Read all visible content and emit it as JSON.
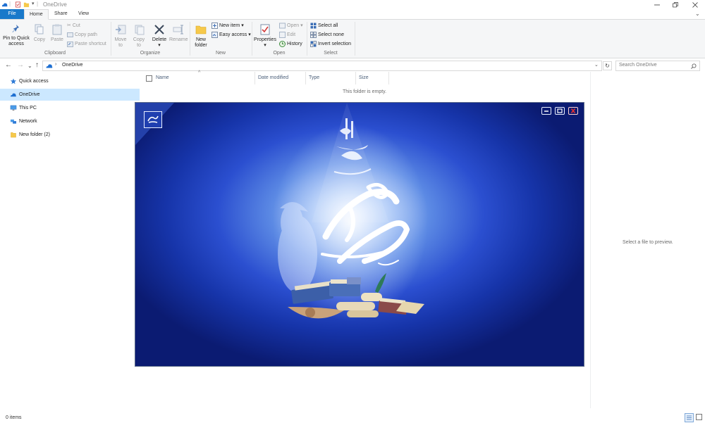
{
  "window": {
    "title": "OneDrive",
    "controls": {
      "minimize_icon": "minimize-icon",
      "restore_icon": "restore-icon",
      "close_icon": "close-icon"
    }
  },
  "tabs": [
    "File",
    "Home",
    "Share",
    "View"
  ],
  "ribbon": {
    "clipboard": {
      "label": "Clipboard",
      "pin": "Pin to Quick access",
      "pin_line1": "Pin to Quick",
      "pin_line2": "access",
      "copy": "Copy",
      "paste": "Paste",
      "cut": "Cut",
      "copy_path": "Copy path",
      "paste_shortcut": "Paste shortcut"
    },
    "organize": {
      "label": "Organize",
      "move_to_1": "Move",
      "move_to_2": "to",
      "copy_to_1": "Copy",
      "copy_to_2": "to",
      "delete": "Delete",
      "rename": "Rename"
    },
    "new": {
      "label": "New",
      "new_folder_1": "New",
      "new_folder_2": "folder",
      "new_item": "New item",
      "easy_access": "Easy access"
    },
    "open": {
      "label": "Open",
      "properties": "Properties",
      "open": "Open",
      "edit": "Edit",
      "history": "History"
    },
    "select": {
      "label": "Select",
      "select_all": "Select all",
      "select_none": "Select none",
      "invert": "Invert selection"
    }
  },
  "address": {
    "path": "OneDrive",
    "search_placeholder": "Search OneDrive"
  },
  "nav": {
    "items": [
      {
        "label": "Quick access",
        "icon": "star-icon"
      },
      {
        "label": "OneDrive",
        "icon": "cloud-icon",
        "selected": true
      },
      {
        "label": "This PC",
        "icon": "monitor-icon"
      },
      {
        "label": "Network",
        "icon": "network-icon"
      },
      {
        "label": "New folder (2)",
        "icon": "folder-icon"
      }
    ]
  },
  "filelist": {
    "columns": [
      "Name",
      "Date modified",
      "Type",
      "Size"
    ],
    "empty_text": "This folder is empty."
  },
  "preview": {
    "text": "Select a file to preview."
  },
  "status": {
    "items": "0 items"
  },
  "overlay": {
    "logo_icon": "calligraphy-logo-icon",
    "artwork": "calligraphy-books-artwork",
    "colors": {
      "deep": "#0b1b72",
      "mid": "#2b4fd0",
      "glow": "#e7f1ff",
      "close": "#e53030"
    }
  }
}
